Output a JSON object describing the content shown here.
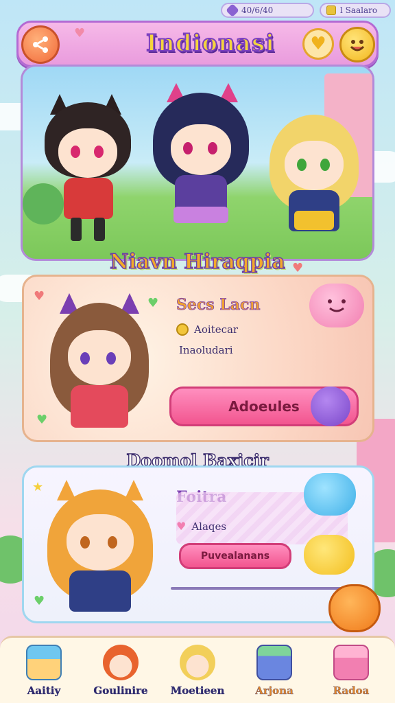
{
  "status": {
    "gems": "40/6/40",
    "gold_label": "l Saalaro"
  },
  "header": {
    "title": "Indionasi"
  },
  "sections": {
    "roster_title": "Niavn Hiraqpia",
    "hero_name": "Secs Lacn",
    "hero_line1": "Aoitecar",
    "hero_line2": "Inaoludari",
    "hero_button": "Adoeules",
    "lower_title": "Doomol  Baxicir",
    "lower_name": "Foitra",
    "lower_line": "Alaqes",
    "lower_button": "Puvealanans"
  },
  "nav": [
    {
      "label": "Aaitiy",
      "icon": "house-icon"
    },
    {
      "label": "Goulinire",
      "icon": "chibi-redhead-icon"
    },
    {
      "label": "Moetieen",
      "icon": "chibi-blonde-icon"
    },
    {
      "label": "Arjona",
      "icon": "shop-icon"
    },
    {
      "label": "Radoa",
      "icon": "giftbox-icon"
    }
  ],
  "colors": {
    "accent": "#e9a0df",
    "button": "#f2558f",
    "nav_bg": "#fff7e6"
  }
}
